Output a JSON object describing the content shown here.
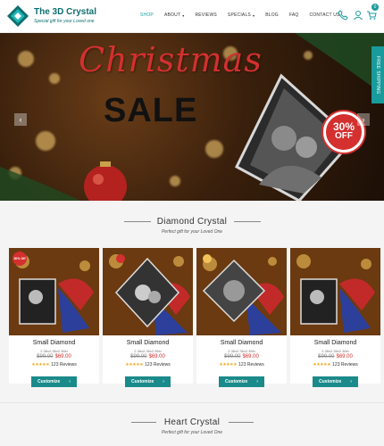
{
  "brand": {
    "name": "The 3D Crystal",
    "tagline": "Special gift for your Loved one"
  },
  "nav": [
    {
      "label": "SHOP",
      "active": true,
      "caret": false
    },
    {
      "label": "ABOUT",
      "active": false,
      "caret": true
    },
    {
      "label": "REVIEWS",
      "active": false,
      "caret": false
    },
    {
      "label": "SPECIALS",
      "active": false,
      "caret": true
    },
    {
      "label": "BLOG",
      "active": false,
      "caret": false
    },
    {
      "label": "FAQ",
      "active": false,
      "caret": false
    },
    {
      "label": "CONTACT US",
      "active": false,
      "caret": false
    }
  ],
  "header_icons": [
    "phone-icon",
    "user-icon",
    "cart-icon"
  ],
  "cart_count": "0",
  "hero": {
    "title": "Christmas",
    "subtitle": "SALE",
    "badge_pct": "30%",
    "badge_off": "OFF",
    "prev_icon": "‹",
    "next_icon": "›"
  },
  "free_shipping": "FREE SHIPPING",
  "section1": {
    "title": "Diamond Crystal",
    "subtitle": "Perfect gift for your Loved One"
  },
  "products": [
    {
      "name": "Small Diamond",
      "size": "2.36x2.36x2.36in",
      "old_price": "$99.00",
      "new_price": "$69.00",
      "stars": "★★★★★",
      "reviews": "123 Reviews",
      "button": "Customize",
      "tag": "30% Off"
    },
    {
      "name": "Small Diamond",
      "size": "2.36x2.36x2.36in",
      "old_price": "$99.00",
      "new_price": "$69.00",
      "stars": "★★★★★",
      "reviews": "123 Reviews",
      "button": "Customize",
      "tag": ""
    },
    {
      "name": "Small Diamond",
      "size": "2.36x2.36x2.36in",
      "old_price": "$99.00",
      "new_price": "$69.00",
      "stars": "★★★★★",
      "reviews": "123 Reviews",
      "button": "Customize",
      "tag": ""
    },
    {
      "name": "Small Diamond",
      "size": "2.36x2.36x2.36in",
      "old_price": "$99.00",
      "new_price": "$69.00",
      "stars": "★★★★★",
      "reviews": "123 Reviews",
      "button": "Customize",
      "tag": ""
    }
  ],
  "button_arrow": "›",
  "section2": {
    "title": "Heart Crystal",
    "subtitle": "Perfect gift for your Loved One"
  },
  "colors": {
    "accent": "#1a9b9b",
    "sale_red": "#d3302f",
    "star": "#f0a91a"
  }
}
